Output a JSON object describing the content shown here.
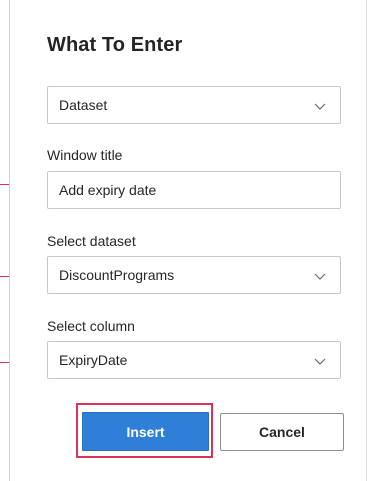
{
  "dialog": {
    "title": "What To Enter"
  },
  "type_select": {
    "value": "Dataset"
  },
  "window_title": {
    "label": "Window title",
    "value": "Add expiry date"
  },
  "dataset_select": {
    "label": "Select dataset",
    "value": "DiscountPrograms"
  },
  "column_select": {
    "label": "Select column",
    "value": "ExpiryDate"
  },
  "buttons": {
    "insert_label": "Insert",
    "cancel_label": "Cancel"
  },
  "colors": {
    "primary": "#2f7fd7",
    "highlight": "#d9335b",
    "border": "#c8c8c8"
  },
  "icons": {
    "dropdown": "chevron-down-icon"
  }
}
